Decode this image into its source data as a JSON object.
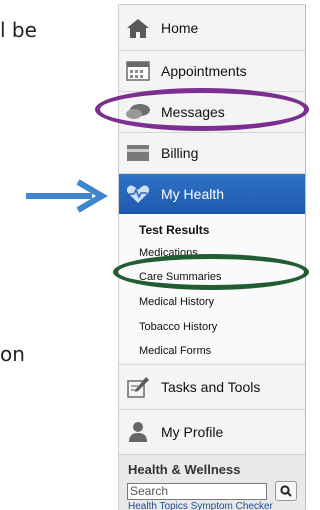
{
  "slide": {
    "fragment_top": "l be",
    "fragment_bottom": "on"
  },
  "nav": {
    "home": "Home",
    "appointments": "Appointments",
    "messages": "Messages",
    "billing": "Billing",
    "my_health": "My Health",
    "tasks_and_tools": "Tasks and Tools",
    "my_profile": "My Profile"
  },
  "submenu": [
    "Test Results",
    "Medications",
    "Care Summaries",
    "Medical History",
    "Tobacco History",
    "Medical Forms"
  ],
  "health_wellness": {
    "title": "Health & Wellness",
    "search_value": "Search",
    "link_topics": "Health Topics",
    "link_symptom": "Symptom Checker"
  },
  "colors": {
    "active_nav": "#2a69bf",
    "arrow": "#3f86cc",
    "highlight_purple": "#7a2f91",
    "highlight_green": "#215d32"
  },
  "icons": [
    "home-icon",
    "calendar-icon",
    "chat-bubbles-icon",
    "credit-card-icon",
    "heart-pulse-icon",
    "edit-icon",
    "person-icon",
    "search-icon"
  ]
}
